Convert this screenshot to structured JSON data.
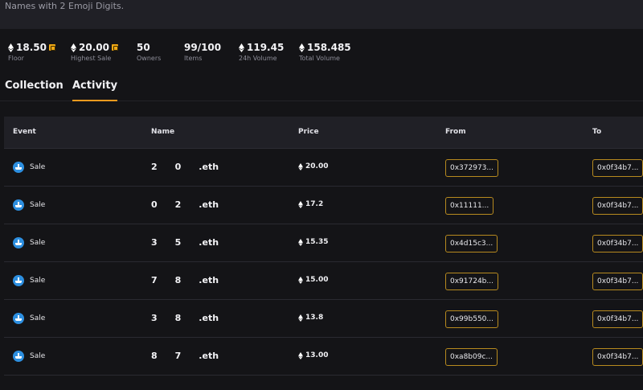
{
  "header": {
    "description": "Names with 2 Emoji Digits."
  },
  "stats": [
    {
      "value": "18.50",
      "label": "Floor",
      "eth": true,
      "badge": true
    },
    {
      "value": "20.00",
      "label": "Highest Sale",
      "eth": true,
      "badge": true
    },
    {
      "value": "50",
      "label": "Owners",
      "eth": false,
      "badge": false
    },
    {
      "value": "99/100",
      "label": "Items",
      "eth": false,
      "badge": false
    },
    {
      "value": "119.45",
      "label": "24h Volume",
      "eth": true,
      "badge": false
    },
    {
      "value": "158.485",
      "label": "Total Volume",
      "eth": true,
      "badge": false
    }
  ],
  "tabs": [
    {
      "label": "Collection",
      "active": false
    },
    {
      "label": "Activity",
      "active": true
    }
  ],
  "table": {
    "columns": [
      "Event",
      "Name",
      "Price",
      "From",
      "To"
    ],
    "rows": [
      {
        "event": "Sale",
        "name": "2  0  .eth",
        "price": "20.00",
        "from": "0x372973...",
        "to": "0x0f34b7..."
      },
      {
        "event": "Sale",
        "name": "0  2  .eth",
        "price": "17.2",
        "from": "0x11111...",
        "to": "0x0f34b7..."
      },
      {
        "event": "Sale",
        "name": "3  5  .eth",
        "price": "15.35",
        "from": "0x4d15c3...",
        "to": "0x0f34b7..."
      },
      {
        "event": "Sale",
        "name": "7  8  .eth",
        "price": "15.00",
        "from": "0x91724b...",
        "to": "0x0f34b7..."
      },
      {
        "event": "Sale",
        "name": "3  8  .eth",
        "price": "13.8",
        "from": "0x99b550...",
        "to": "0x0f34b7..."
      },
      {
        "event": "Sale",
        "name": "8  7  .eth",
        "price": "13.00",
        "from": "0xa8b09c...",
        "to": "0x0f34b7..."
      }
    ]
  },
  "colors": {
    "accent": "#f09a1e",
    "sale_icon": "#2d8fe0",
    "address_border": "#b78a1f",
    "background": "#141417"
  }
}
